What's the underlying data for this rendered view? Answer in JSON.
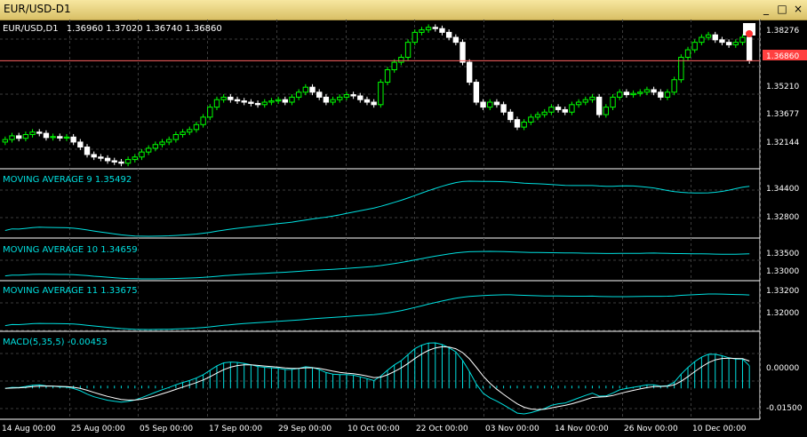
{
  "window": {
    "title": "EUR/USD-D1",
    "minimize_glyph": "_",
    "maximize_glyph": "□",
    "close_glyph": "×"
  },
  "colors": {
    "background": "#000000",
    "grid": "#3c3c3c",
    "bull": "#00ff00",
    "bear": "#ffffff",
    "ma_line": "#00e0e0",
    "macd": "#00e0e0",
    "signal": "#ffffff",
    "price_line": "#ff6060",
    "price_label_bg": "#ff4040",
    "label_text": "#00e0e0",
    "axis_text": "#ffffff"
  },
  "main_chart": {
    "symbol_label": "EUR/USD,D1",
    "ohlc_text": "1.36960  1.37020  1.36740  1.36860",
    "y_ticks": [
      "1.38276",
      "1.35210",
      "1.33677",
      "1.32144"
    ],
    "current_price": "1.36860"
  },
  "indicators": [
    {
      "label": "MOVING AVERAGE 9   1.35492",
      "ticks": [
        "1.34400",
        "1.32800"
      ]
    },
    {
      "label": "MOVING AVERAGE 10   1.34659",
      "ticks": [
        "1.33500",
        "1.33000"
      ]
    },
    {
      "label": "MOVING AVERAGE 11   1.33675",
      "ticks": [
        "1.33200",
        "1.32000"
      ]
    }
  ],
  "macd": {
    "label": "MACD(5,35,5)  -0.00453",
    "ticks": [
      "0.00000",
      "-0.01500"
    ]
  },
  "x_ticks": [
    "14 Aug 00:00",
    "25 Aug 00:00",
    "05 Sep 00:00",
    "17 Sep 00:00",
    "29 Sep 00:00",
    "10 Oct 00:00",
    "22 Oct 00:00",
    "03 Nov 00:00",
    "14 Nov 00:00",
    "26 Nov 00:00",
    "10 Dec 00:00"
  ],
  "chart_data": {
    "type": "candlestick",
    "title": "EUR/USD,D1",
    "close_series": [
      1.337,
      1.3385,
      1.3375,
      1.339,
      1.34,
      1.3395,
      1.3378,
      1.3382,
      1.3376,
      1.338,
      1.336,
      1.334,
      1.331,
      1.33,
      1.3295,
      1.3285,
      1.328,
      1.3275,
      1.329,
      1.33,
      1.332,
      1.3335,
      1.335,
      1.336,
      1.337,
      1.339,
      1.34,
      1.341,
      1.343,
      1.346,
      1.35,
      1.353,
      1.354,
      1.353,
      1.3525,
      1.352,
      1.3515,
      1.351,
      1.352,
      1.3525,
      1.353,
      1.352,
      1.354,
      1.356,
      1.358,
      1.356,
      1.354,
      1.352,
      1.353,
      1.354,
      1.355,
      1.3545,
      1.353,
      1.352,
      1.351,
      1.36,
      1.365,
      1.368,
      1.37,
      1.376,
      1.38,
      1.381,
      1.382,
      1.3815,
      1.38,
      1.378,
      1.376,
      1.368,
      1.36,
      1.352,
      1.35,
      1.352,
      1.351,
      1.348,
      1.345,
      1.342,
      1.344,
      1.346,
      1.347,
      1.348,
      1.35,
      1.349,
      1.348,
      1.351,
      1.352,
      1.353,
      1.354,
      1.347,
      1.35,
      1.354,
      1.356,
      1.355,
      1.3555,
      1.356,
      1.357,
      1.356,
      1.354,
      1.356,
      1.361,
      1.37,
      1.373,
      1.376,
      1.378,
      1.379,
      1.377,
      1.376,
      1.375,
      1.376,
      1.378,
      1.3686
    ],
    "yaxis_ticks": [
      1.38276,
      1.3521,
      1.33677,
      1.32144
    ],
    "current_price": 1.3686,
    "moving_averages": [
      {
        "name": "MOVING AVERAGE 9",
        "last": 1.35492
      },
      {
        "name": "MOVING AVERAGE 10",
        "last": 1.34659
      },
      {
        "name": "MOVING AVERAGE 11",
        "last": 1.33675
      }
    ],
    "macd": {
      "params": "5,35,5",
      "last": -0.00453
    }
  }
}
